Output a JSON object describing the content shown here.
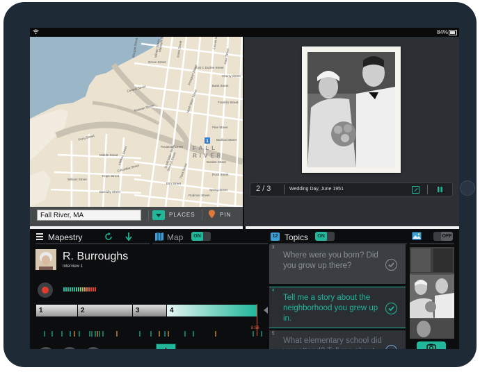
{
  "statusbar": {
    "battery": "84%"
  },
  "map": {
    "location_value": "Fall River, MA",
    "places_label": "PLACES",
    "pin_label": "PIN",
    "city_label": "FALL RIVER",
    "marker_number": "1",
    "streets": [
      "Locust Street",
      "June Street",
      "B M C Durfee Street",
      "Cherry Street",
      "Central Street",
      "Bank Street",
      "Franklin Street",
      "North Main Street",
      "Prospect Street",
      "Pine Street",
      "Ferry Street",
      "Milliken Street",
      "Columbia Street",
      "Middle Street",
      "Hope Street",
      "Elm Street",
      "Rock Street",
      "William Street",
      "South Main Street",
      "Borden Street",
      "Rodman Street",
      "Spring Street",
      "Anawan Street",
      "Second Street",
      "Bedford Street",
      "Winter Street",
      "Madison Street",
      "Davis Street",
      "Barnaby Street",
      "Morgan Street",
      "Pocasset Street",
      "Third Street",
      "Grove Street"
    ]
  },
  "photo": {
    "counter": "2 / 3",
    "caption": "Wedding Day, June 1951"
  },
  "toolbar": {
    "app_title": "Mapestry",
    "map_label": "Map",
    "map_toggle": "ON",
    "topics_badge": "12",
    "topics_label": "Topics",
    "topics_toggle": "ON",
    "photos_toggle": "OFF"
  },
  "interview": {
    "name": "R. Burroughs",
    "subtitle": "Interview 1",
    "segments": [
      "1",
      "2",
      "3",
      "4"
    ],
    "time": "8:56"
  },
  "topics": [
    {
      "num": "3",
      "text": "Where were you born? Did you grow up there?"
    },
    {
      "num": "4",
      "text": "Tell me a story about the neighborhood you grew up in."
    },
    {
      "num": "5",
      "text": "What elementary school did you attend? Tell me about your friends there."
    }
  ],
  "colors": {
    "accent": "#20b79a",
    "record": "#e03c2c",
    "timeline_marker": "#e06040"
  }
}
